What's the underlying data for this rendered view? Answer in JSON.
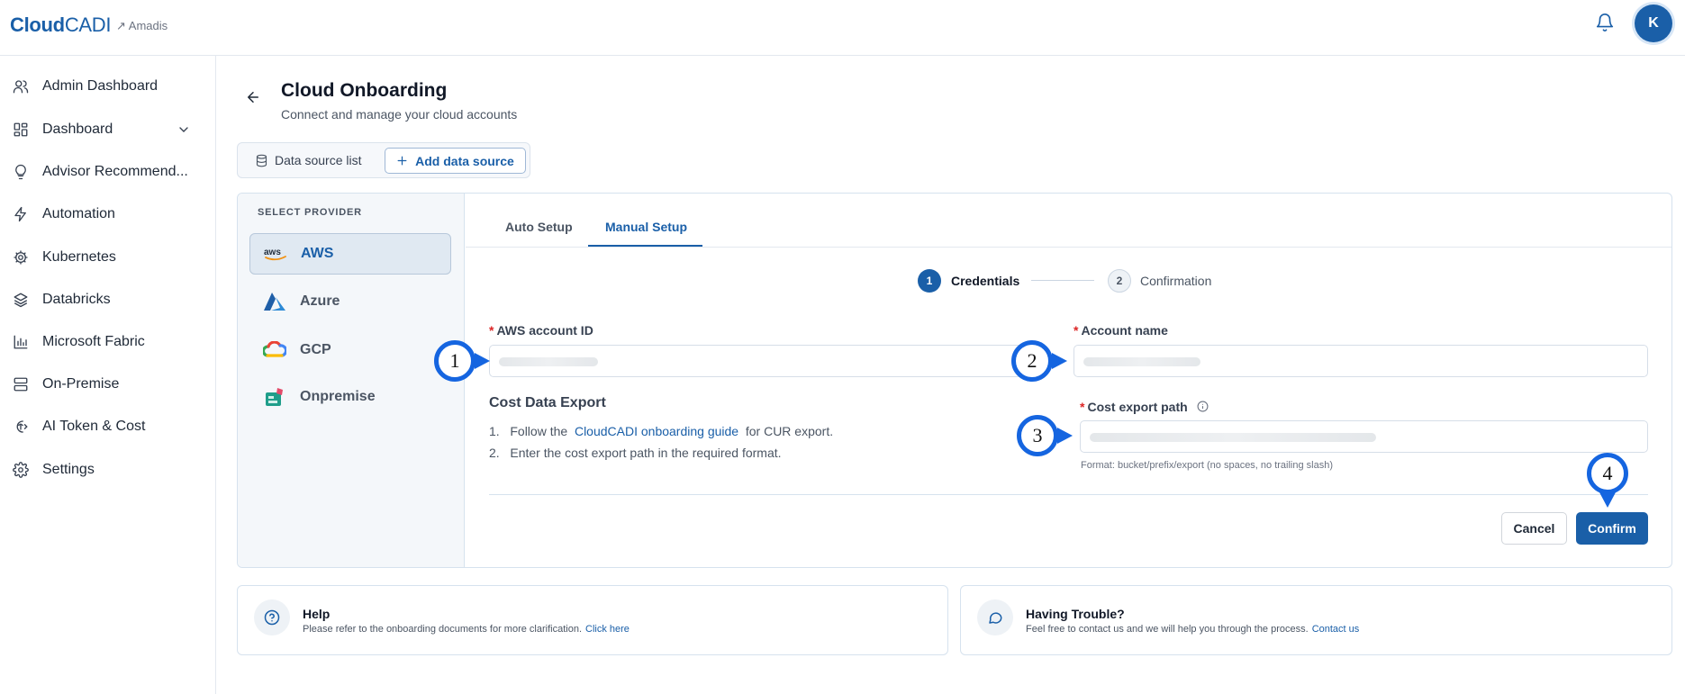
{
  "header": {
    "logo_bold": "Cloud",
    "logo_regular": "CADI",
    "org_name": "↗ Amadis",
    "avatar_initial": "K"
  },
  "sidebar": {
    "items": [
      {
        "label": "Admin Dashboard",
        "icon": "users-icon"
      },
      {
        "label": "Dashboard",
        "icon": "dashboard-icon"
      },
      {
        "label": "Advisor Recommend...",
        "icon": "lightbulb-icon"
      },
      {
        "label": "Automation",
        "icon": "bolt-icon"
      },
      {
        "label": "Kubernetes",
        "icon": "helm-icon"
      },
      {
        "label": "Databricks",
        "icon": "layers-icon"
      },
      {
        "label": "Microsoft Fabric",
        "icon": "bar-chart-icon"
      },
      {
        "label": "On-Premise",
        "icon": "server-icon"
      },
      {
        "label": "AI Token & Cost",
        "icon": "ai-cost-icon"
      },
      {
        "label": "Settings",
        "icon": "gear-icon"
      }
    ]
  },
  "page": {
    "title": "Cloud Onboarding",
    "subtitle": "Connect and manage your cloud accounts"
  },
  "datasource": {
    "list_label": "Data source list",
    "add_label": "Add data source"
  },
  "providers": {
    "heading": "SELECT PROVIDER",
    "items": [
      {
        "label": "AWS",
        "selected": true
      },
      {
        "label": "Azure"
      },
      {
        "label": "GCP"
      },
      {
        "label": "Onpremise"
      }
    ]
  },
  "tabs": [
    {
      "label": "Auto Setup"
    },
    {
      "label": "Manual Setup",
      "active": true
    }
  ],
  "steps": [
    {
      "number": "1",
      "label": "Credentials",
      "active": true
    },
    {
      "number": "2",
      "label": "Confirmation"
    }
  ],
  "form": {
    "aws_account_id_label": "AWS account ID",
    "account_name_label": "Account name",
    "cost_export_path_label": "Cost export path",
    "format_hint": "Format: bucket/prefix/export (no spaces, no trailing slash)",
    "required_mark": "*"
  },
  "cost_export": {
    "title": "Cost Data Export",
    "step1_num": "1.",
    "step1_prefix": "Follow the",
    "step1_link": "CloudCADI onboarding guide",
    "step1_suffix": "for CUR export.",
    "step2_num": "2.",
    "step2_text": "Enter the cost export path in the required format."
  },
  "actions": {
    "cancel": "Cancel",
    "confirm": "Confirm"
  },
  "help": {
    "title": "Help",
    "text": "Please refer to the onboarding documents for more clarification.",
    "link": "Click here"
  },
  "trouble": {
    "title": "Having Trouble?",
    "text": "Feel free to contact us and we will help you through the process.",
    "link": "Contact us"
  },
  "callouts": [
    "1",
    "2",
    "3",
    "4"
  ],
  "colors": {
    "primary": "#1a5fa8",
    "callout_ring": "#1565e0",
    "required": "#dc2626"
  }
}
